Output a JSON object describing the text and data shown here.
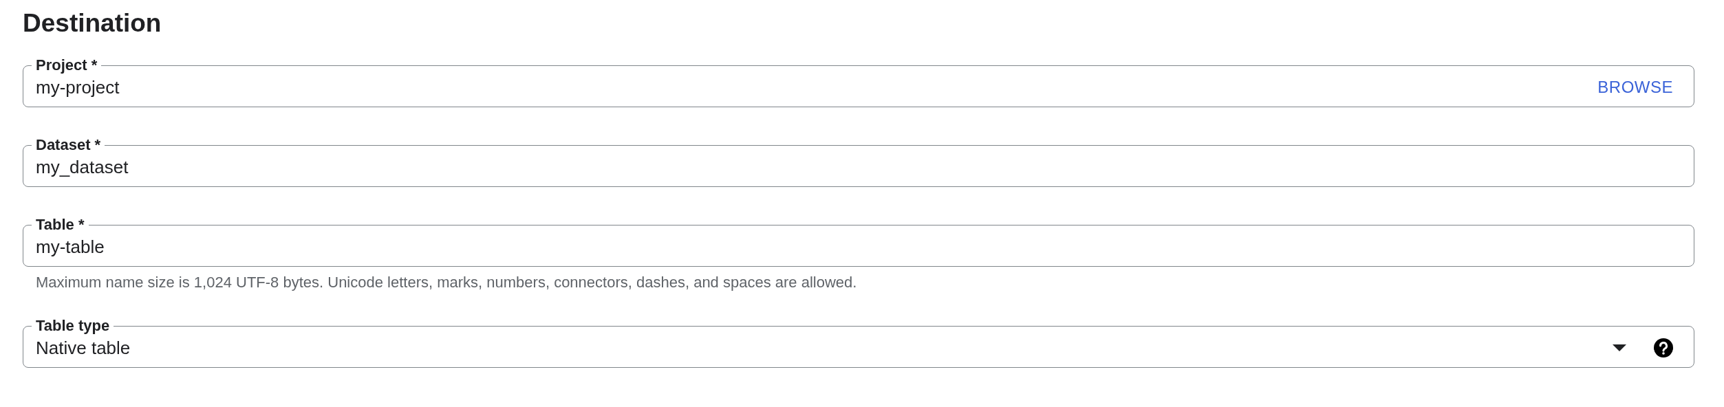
{
  "title": "Destination",
  "fields": [
    {
      "kind": "text",
      "label": "Project *",
      "value": "my-project",
      "action": "BROWSE"
    },
    {
      "kind": "text",
      "label": "Dataset *",
      "value": "my_dataset"
    },
    {
      "kind": "text",
      "label": "Table *",
      "value": "my-table",
      "helper": "Maximum name size is 1,024 UTF-8 bytes. Unicode letters, marks, numbers, connectors, dashes, and spaces are allowed."
    },
    {
      "kind": "select",
      "label": "Table type",
      "value": "Native table",
      "help": true
    }
  ]
}
